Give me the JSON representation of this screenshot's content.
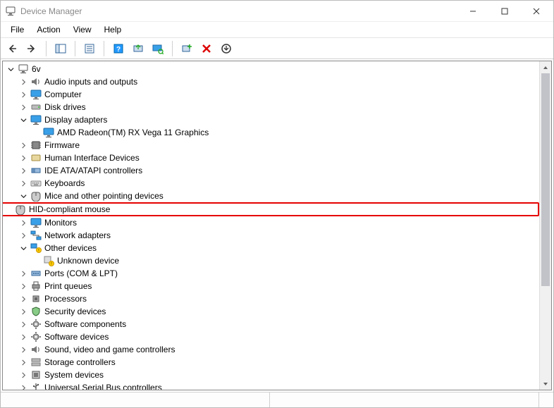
{
  "window": {
    "title": "Device Manager"
  },
  "menubar": {
    "items": [
      {
        "label": "File"
      },
      {
        "label": "Action"
      },
      {
        "label": "View"
      },
      {
        "label": "Help"
      }
    ]
  },
  "toolbar": {
    "back_tip": "Back",
    "forward_tip": "Forward",
    "showhide_tip": "Show/Hide Console Tree",
    "properties_tip": "Properties",
    "help_tip": "Help",
    "update_tip": "Update driver",
    "scan_tip": "Scan for hardware changes",
    "addlegacy_tip": "Add legacy hardware",
    "uninstall_tip": "Uninstall device",
    "disable_tip": "Disable device"
  },
  "tree": {
    "root": {
      "label": "6v",
      "icon": "computer-icon"
    },
    "items": [
      {
        "label": "Audio inputs and outputs",
        "icon": "audio-icon",
        "exp": "closed"
      },
      {
        "label": "Computer",
        "icon": "monitor-icon",
        "exp": "closed"
      },
      {
        "label": "Disk drives",
        "icon": "disk-icon",
        "exp": "closed"
      },
      {
        "label": "Display adapters",
        "icon": "monitor-icon",
        "exp": "open",
        "children": [
          {
            "label": "AMD Radeon(TM) RX Vega 11 Graphics",
            "icon": "monitor-icon"
          }
        ]
      },
      {
        "label": "Firmware",
        "icon": "firmware-icon",
        "exp": "closed"
      },
      {
        "label": "Human Interface Devices",
        "icon": "hid-icon",
        "exp": "closed"
      },
      {
        "label": "IDE ATA/ATAPI controllers",
        "icon": "ide-icon",
        "exp": "closed"
      },
      {
        "label": "Keyboards",
        "icon": "keyboard-icon",
        "exp": "closed"
      },
      {
        "label": "Mice and other pointing devices",
        "icon": "mouse-icon",
        "exp": "open",
        "children": [
          {
            "label": "HID-compliant mouse",
            "icon": "mouse-icon",
            "highlight": true
          }
        ]
      },
      {
        "label": "Monitors",
        "icon": "monitor-icon",
        "exp": "closed"
      },
      {
        "label": "Network adapters",
        "icon": "network-icon",
        "exp": "closed"
      },
      {
        "label": "Other devices",
        "icon": "other-icon",
        "exp": "open",
        "children": [
          {
            "label": "Unknown device",
            "icon": "unknown-icon"
          }
        ]
      },
      {
        "label": "Ports (COM & LPT)",
        "icon": "port-icon",
        "exp": "closed"
      },
      {
        "label": "Print queues",
        "icon": "printer-icon",
        "exp": "closed"
      },
      {
        "label": "Processors",
        "icon": "cpu-icon",
        "exp": "closed"
      },
      {
        "label": "Security devices",
        "icon": "security-icon",
        "exp": "closed"
      },
      {
        "label": "Software components",
        "icon": "software-icon",
        "exp": "closed"
      },
      {
        "label": "Software devices",
        "icon": "software-icon",
        "exp": "closed"
      },
      {
        "label": "Sound, video and game controllers",
        "icon": "audio-icon",
        "exp": "closed"
      },
      {
        "label": "Storage controllers",
        "icon": "storage-icon",
        "exp": "closed"
      },
      {
        "label": "System devices",
        "icon": "system-icon",
        "exp": "closed"
      },
      {
        "label": "Universal Serial Bus controllers",
        "icon": "usb-icon",
        "exp": "closed"
      }
    ]
  }
}
